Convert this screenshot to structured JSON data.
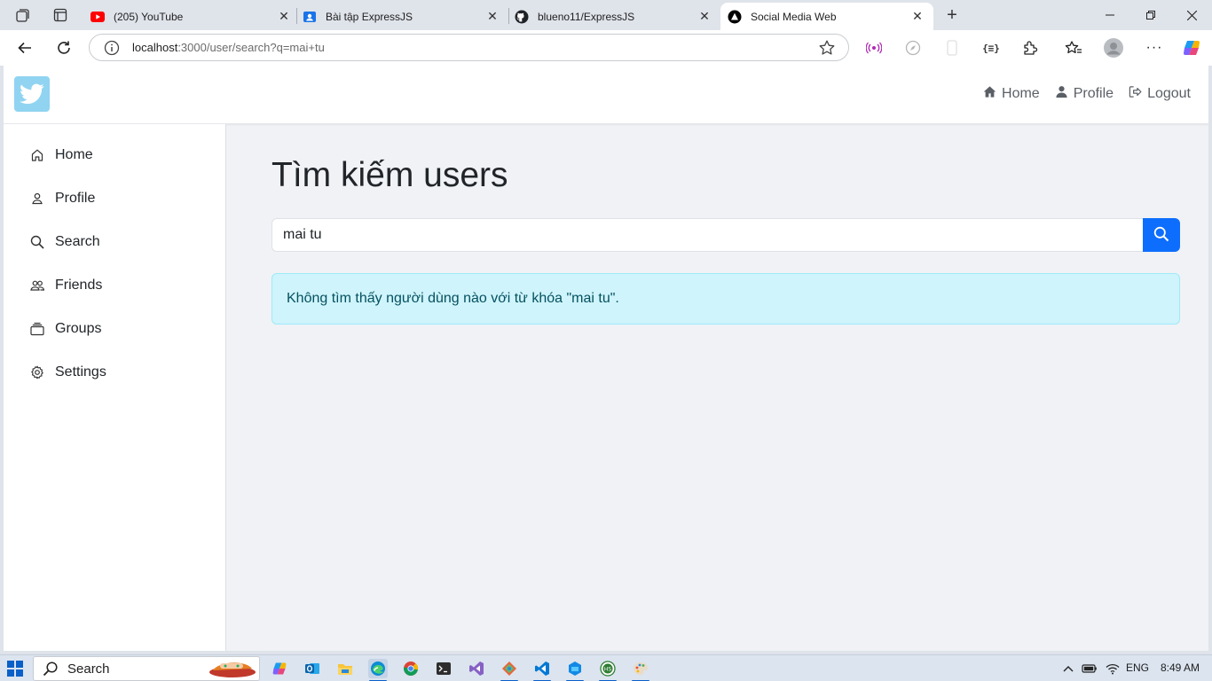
{
  "browser": {
    "tabs": [
      {
        "title": "(205) YouTube",
        "icon": "youtube-icon",
        "active": false
      },
      {
        "title": "Bài tập ExpressJS",
        "icon": "classroom-icon",
        "active": false
      },
      {
        "title": "blueno11/ExpressJS",
        "icon": "github-icon",
        "active": false
      },
      {
        "title": "Social Media Web",
        "icon": "nextjs-icon",
        "active": true
      }
    ],
    "address": {
      "host": "localhost",
      "rest": ":3000/user/search?q=mai+tu"
    }
  },
  "site": {
    "nav": {
      "home": "Home",
      "profile": "Profile",
      "logout": "Logout"
    },
    "sidebar": {
      "items": [
        {
          "label": "Home",
          "icon": "home-icon"
        },
        {
          "label": "Profile",
          "icon": "person-icon"
        },
        {
          "label": "Search",
          "icon": "search-icon"
        },
        {
          "label": "Friends",
          "icon": "people-icon"
        },
        {
          "label": "Groups",
          "icon": "groups-icon"
        },
        {
          "label": "Settings",
          "icon": "gear-icon"
        }
      ]
    },
    "main": {
      "title": "Tìm kiếm users",
      "search_value": "mai tu",
      "alert": "Không tìm thấy người dùng nào với từ khóa \"mai tu\"."
    },
    "colors": {
      "primary": "#0d6efd",
      "alert_bg": "#cff4fc",
      "alert_text": "#055160",
      "logo_bg": "#90d4f1"
    }
  },
  "taskbar": {
    "search_label": "Search",
    "language": "ENG",
    "time": "8:49 AM"
  }
}
